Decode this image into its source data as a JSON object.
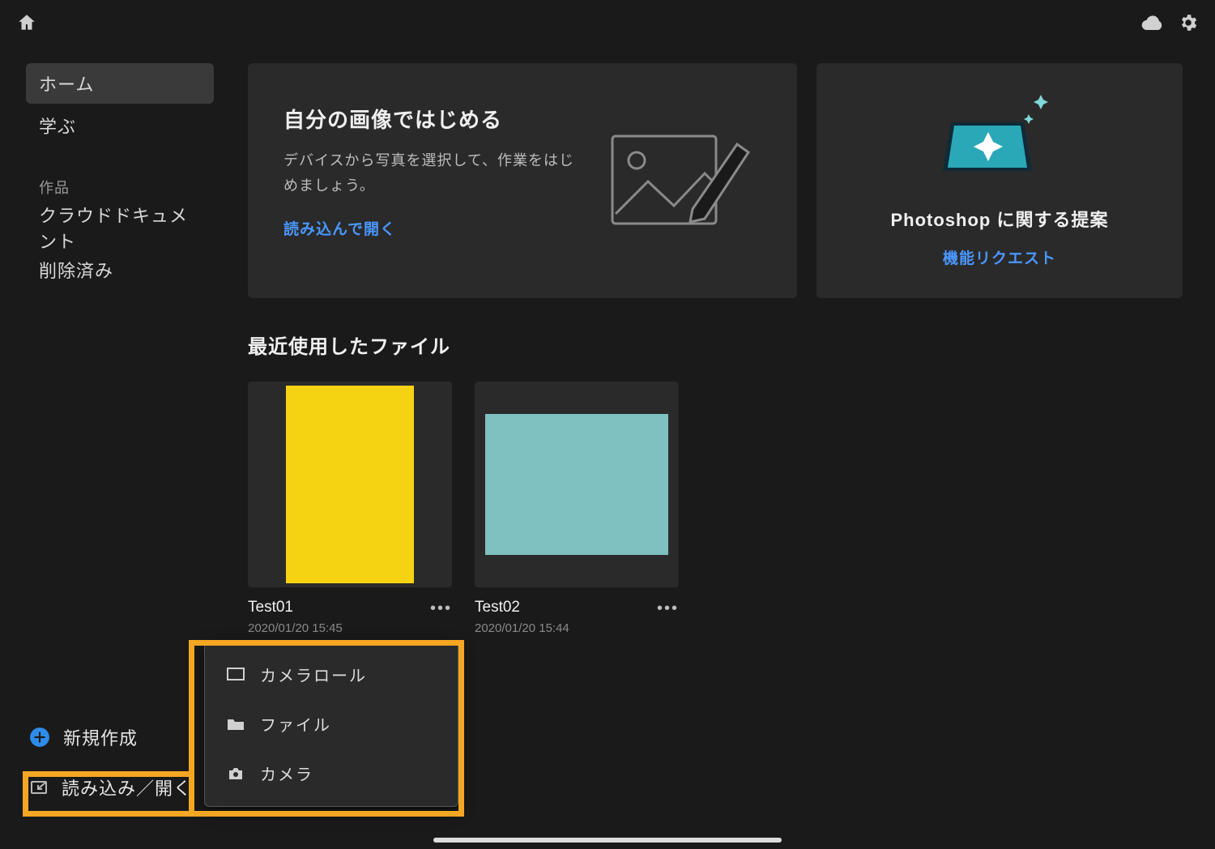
{
  "sidebar": {
    "items": [
      {
        "label": "ホーム"
      },
      {
        "label": "学ぶ"
      }
    ],
    "worksHeading": "作品",
    "works": [
      {
        "label": "クラウドドキュメント"
      },
      {
        "label": "削除済み"
      }
    ]
  },
  "cards": {
    "intro": {
      "title": "自分の画像ではじめる",
      "body": "デバイスから写真を選択して、作業をはじめましょう。",
      "link": "読み込んで開く"
    },
    "suggest": {
      "title": "Photoshop に関する提案",
      "link": "機能リクエスト"
    }
  },
  "recent": {
    "heading": "最近使用したファイル",
    "files": [
      {
        "name": "Test01",
        "date": "2020/01/20 15:45"
      },
      {
        "name": "Test02",
        "date": "2020/01/20 15:44"
      }
    ]
  },
  "actions": {
    "new": "新規作成",
    "open": "読み込み／開く"
  },
  "popup": {
    "items": [
      {
        "label": "カメラロール"
      },
      {
        "label": "ファイル"
      },
      {
        "label": "カメラ"
      }
    ]
  }
}
